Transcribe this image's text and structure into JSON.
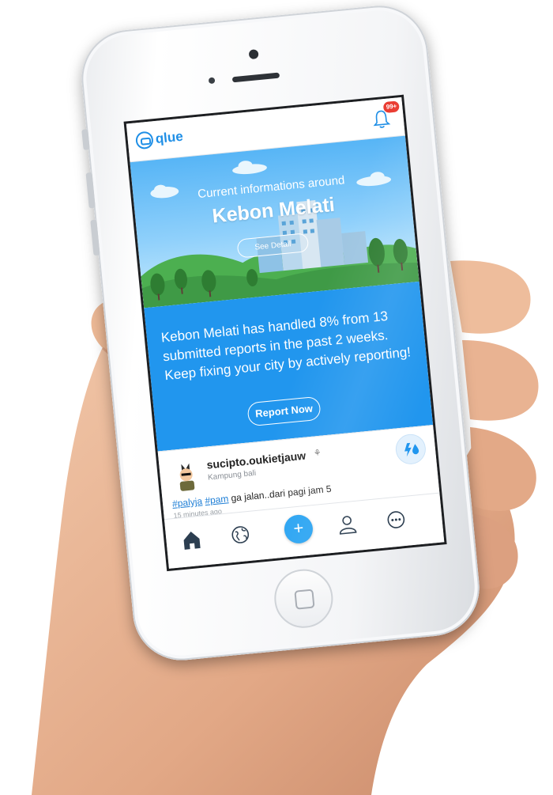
{
  "app": {
    "logo_text": "qlue",
    "notification_count": "99+"
  },
  "hero": {
    "subtitle": "Current informations around",
    "location": "Kebon Melati",
    "detail_button": "See Detail"
  },
  "stat_panel": {
    "message": "Kebon Melati has handled 8% from 13 submitted reports in the past 2 weeks. Keep fixing your city by actively reporting!",
    "report_button": "Report Now"
  },
  "post": {
    "username": "sucipto.oukietjauw",
    "location": "Kampung bali",
    "hashtag_1": "#palyja",
    "hashtag_2": "#pam",
    "text": "ga jalan..dari pagi jam 5",
    "time": "15 minutes ago",
    "category_icon": "water-drop-lightning-icon"
  },
  "bottom_nav": {
    "items": [
      "home-icon",
      "globe-icon",
      "add-icon",
      "profile-icon",
      "more-icon"
    ],
    "add_label": "+"
  },
  "colors": {
    "accent": "#2196ee",
    "logo": "#1f8fe6",
    "badge": "#ea3c32",
    "hashtag": "#1f7fd6"
  }
}
